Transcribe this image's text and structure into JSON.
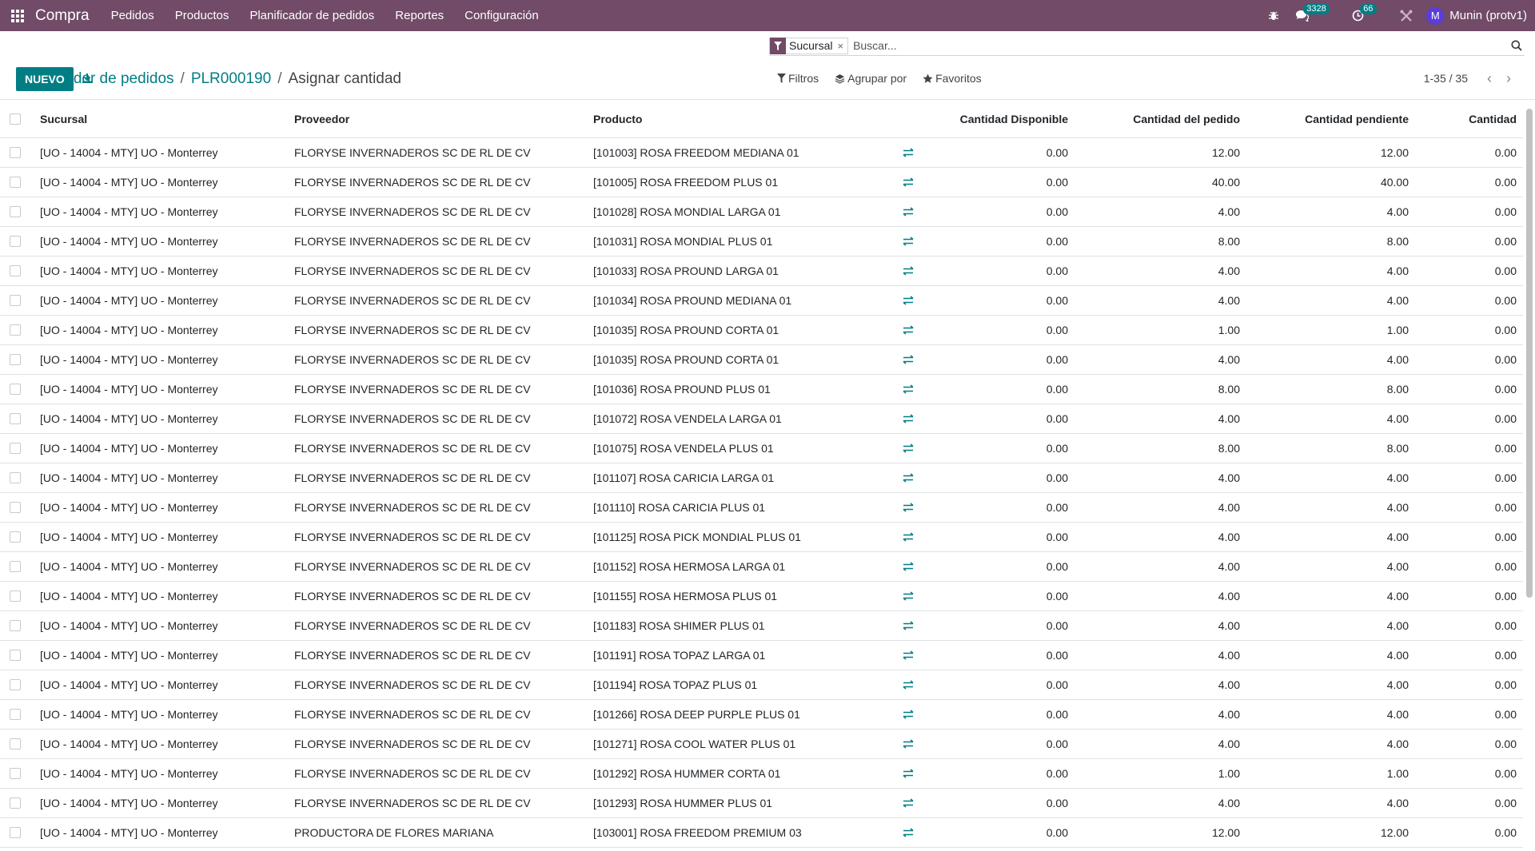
{
  "navbar": {
    "brand": "Compra",
    "menu": [
      "Pedidos",
      "Productos",
      "Planificador de pedidos",
      "Reportes",
      "Configuración"
    ],
    "chat_count": "3328",
    "activity_count": "66",
    "user_initial": "M",
    "user_name": "Munin (protv1)"
  },
  "breadcrumb": {
    "items": [
      "Planificador de pedidos",
      "PLR000190"
    ],
    "current": "Asignar cantidad"
  },
  "actions": {
    "new_label": "NUEVO"
  },
  "search": {
    "facet": "Sucursal",
    "placeholder": "Buscar..."
  },
  "filters": {
    "filters_label": "Filtros",
    "groupby_label": "Agrupar por",
    "favorites_label": "Favoritos"
  },
  "pager": {
    "value": "1-35 / 35"
  },
  "table": {
    "headers": {
      "sucursal": "Sucursal",
      "proveedor": "Proveedor",
      "producto": "Producto",
      "disponible": "Cantidad Disponible",
      "pedido": "Cantidad del pedido",
      "pendiente": "Cantidad pendiente",
      "cantidad": "Cantidad"
    },
    "rows": [
      {
        "sucursal": "[UO - 14004 - MTY] UO - Monterrey",
        "proveedor": "FLORYSE INVERNADEROS SC DE RL DE CV",
        "producto": "[101003] ROSA FREEDOM MEDIANA 01",
        "disponible": "0.00",
        "pedido": "12.00",
        "pendiente": "12.00",
        "cantidad": "0.00"
      },
      {
        "sucursal": "[UO - 14004 - MTY] UO - Monterrey",
        "proveedor": "FLORYSE INVERNADEROS SC DE RL DE CV",
        "producto": "[101005] ROSA FREEDOM PLUS 01",
        "disponible": "0.00",
        "pedido": "40.00",
        "pendiente": "40.00",
        "cantidad": "0.00"
      },
      {
        "sucursal": "[UO - 14004 - MTY] UO - Monterrey",
        "proveedor": "FLORYSE INVERNADEROS SC DE RL DE CV",
        "producto": "[101028] ROSA MONDIAL LARGA 01",
        "disponible": "0.00",
        "pedido": "4.00",
        "pendiente": "4.00",
        "cantidad": "0.00"
      },
      {
        "sucursal": "[UO - 14004 - MTY] UO - Monterrey",
        "proveedor": "FLORYSE INVERNADEROS SC DE RL DE CV",
        "producto": "[101031] ROSA MONDIAL PLUS 01",
        "disponible": "0.00",
        "pedido": "8.00",
        "pendiente": "8.00",
        "cantidad": "0.00"
      },
      {
        "sucursal": "[UO - 14004 - MTY] UO - Monterrey",
        "proveedor": "FLORYSE INVERNADEROS SC DE RL DE CV",
        "producto": "[101033] ROSA PROUND LARGA 01",
        "disponible": "0.00",
        "pedido": "4.00",
        "pendiente": "4.00",
        "cantidad": "0.00"
      },
      {
        "sucursal": "[UO - 14004 - MTY] UO - Monterrey",
        "proveedor": "FLORYSE INVERNADEROS SC DE RL DE CV",
        "producto": "[101034] ROSA PROUND MEDIANA 01",
        "disponible": "0.00",
        "pedido": "4.00",
        "pendiente": "4.00",
        "cantidad": "0.00"
      },
      {
        "sucursal": "[UO - 14004 - MTY] UO - Monterrey",
        "proveedor": "FLORYSE INVERNADEROS SC DE RL DE CV",
        "producto": "[101035] ROSA PROUND CORTA 01",
        "disponible": "0.00",
        "pedido": "1.00",
        "pendiente": "1.00",
        "cantidad": "0.00"
      },
      {
        "sucursal": "[UO - 14004 - MTY] UO - Monterrey",
        "proveedor": "FLORYSE INVERNADEROS SC DE RL DE CV",
        "producto": "[101035] ROSA PROUND CORTA 01",
        "disponible": "0.00",
        "pedido": "4.00",
        "pendiente": "4.00",
        "cantidad": "0.00"
      },
      {
        "sucursal": "[UO - 14004 - MTY] UO - Monterrey",
        "proveedor": "FLORYSE INVERNADEROS SC DE RL DE CV",
        "producto": "[101036] ROSA PROUND PLUS 01",
        "disponible": "0.00",
        "pedido": "8.00",
        "pendiente": "8.00",
        "cantidad": "0.00"
      },
      {
        "sucursal": "[UO - 14004 - MTY] UO - Monterrey",
        "proveedor": "FLORYSE INVERNADEROS SC DE RL DE CV",
        "producto": "[101072] ROSA VENDELA LARGA 01",
        "disponible": "0.00",
        "pedido": "4.00",
        "pendiente": "4.00",
        "cantidad": "0.00"
      },
      {
        "sucursal": "[UO - 14004 - MTY] UO - Monterrey",
        "proveedor": "FLORYSE INVERNADEROS SC DE RL DE CV",
        "producto": "[101075] ROSA VENDELA PLUS 01",
        "disponible": "0.00",
        "pedido": "8.00",
        "pendiente": "8.00",
        "cantidad": "0.00"
      },
      {
        "sucursal": "[UO - 14004 - MTY] UO - Monterrey",
        "proveedor": "FLORYSE INVERNADEROS SC DE RL DE CV",
        "producto": "[101107] ROSA CARICIA LARGA 01",
        "disponible": "0.00",
        "pedido": "4.00",
        "pendiente": "4.00",
        "cantidad": "0.00"
      },
      {
        "sucursal": "[UO - 14004 - MTY] UO - Monterrey",
        "proveedor": "FLORYSE INVERNADEROS SC DE RL DE CV",
        "producto": "[101110] ROSA CARICIA PLUS 01",
        "disponible": "0.00",
        "pedido": "4.00",
        "pendiente": "4.00",
        "cantidad": "0.00"
      },
      {
        "sucursal": "[UO - 14004 - MTY] UO - Monterrey",
        "proveedor": "FLORYSE INVERNADEROS SC DE RL DE CV",
        "producto": "[101125] ROSA PICK MONDIAL PLUS 01",
        "disponible": "0.00",
        "pedido": "4.00",
        "pendiente": "4.00",
        "cantidad": "0.00"
      },
      {
        "sucursal": "[UO - 14004 - MTY] UO - Monterrey",
        "proveedor": "FLORYSE INVERNADEROS SC DE RL DE CV",
        "producto": "[101152] ROSA HERMOSA LARGA 01",
        "disponible": "0.00",
        "pedido": "4.00",
        "pendiente": "4.00",
        "cantidad": "0.00"
      },
      {
        "sucursal": "[UO - 14004 - MTY] UO - Monterrey",
        "proveedor": "FLORYSE INVERNADEROS SC DE RL DE CV",
        "producto": "[101155] ROSA HERMOSA PLUS 01",
        "disponible": "0.00",
        "pedido": "4.00",
        "pendiente": "4.00",
        "cantidad": "0.00"
      },
      {
        "sucursal": "[UO - 14004 - MTY] UO - Monterrey",
        "proveedor": "FLORYSE INVERNADEROS SC DE RL DE CV",
        "producto": "[101183] ROSA SHIMER PLUS 01",
        "disponible": "0.00",
        "pedido": "4.00",
        "pendiente": "4.00",
        "cantidad": "0.00"
      },
      {
        "sucursal": "[UO - 14004 - MTY] UO - Monterrey",
        "proveedor": "FLORYSE INVERNADEROS SC DE RL DE CV",
        "producto": "[101191] ROSA TOPAZ LARGA 01",
        "disponible": "0.00",
        "pedido": "4.00",
        "pendiente": "4.00",
        "cantidad": "0.00"
      },
      {
        "sucursal": "[UO - 14004 - MTY] UO - Monterrey",
        "proveedor": "FLORYSE INVERNADEROS SC DE RL DE CV",
        "producto": "[101194] ROSA TOPAZ PLUS 01",
        "disponible": "0.00",
        "pedido": "4.00",
        "pendiente": "4.00",
        "cantidad": "0.00"
      },
      {
        "sucursal": "[UO - 14004 - MTY] UO - Monterrey",
        "proveedor": "FLORYSE INVERNADEROS SC DE RL DE CV",
        "producto": "[101266] ROSA DEEP PURPLE PLUS 01",
        "disponible": "0.00",
        "pedido": "4.00",
        "pendiente": "4.00",
        "cantidad": "0.00"
      },
      {
        "sucursal": "[UO - 14004 - MTY] UO - Monterrey",
        "proveedor": "FLORYSE INVERNADEROS SC DE RL DE CV",
        "producto": "[101271] ROSA COOL WATER PLUS 01",
        "disponible": "0.00",
        "pedido": "4.00",
        "pendiente": "4.00",
        "cantidad": "0.00"
      },
      {
        "sucursal": "[UO - 14004 - MTY] UO - Monterrey",
        "proveedor": "FLORYSE INVERNADEROS SC DE RL DE CV",
        "producto": "[101292] ROSA HUMMER CORTA 01",
        "disponible": "0.00",
        "pedido": "1.00",
        "pendiente": "1.00",
        "cantidad": "0.00"
      },
      {
        "sucursal": "[UO - 14004 - MTY] UO - Monterrey",
        "proveedor": "FLORYSE INVERNADEROS SC DE RL DE CV",
        "producto": "[101293] ROSA HUMMER PLUS 01",
        "disponible": "0.00",
        "pedido": "4.00",
        "pendiente": "4.00",
        "cantidad": "0.00"
      },
      {
        "sucursal": "[UO - 14004 - MTY] UO - Monterrey",
        "proveedor": "PRODUCTORA DE FLORES MARIANA",
        "producto": "[103001] ROSA FREEDOM PREMIUM 03",
        "disponible": "0.00",
        "pedido": "12.00",
        "pendiente": "12.00",
        "cantidad": "0.00"
      }
    ]
  },
  "colors": {
    "navbar": "#714b67",
    "primary": "#017e84",
    "avatar": "#5b3ddb"
  }
}
